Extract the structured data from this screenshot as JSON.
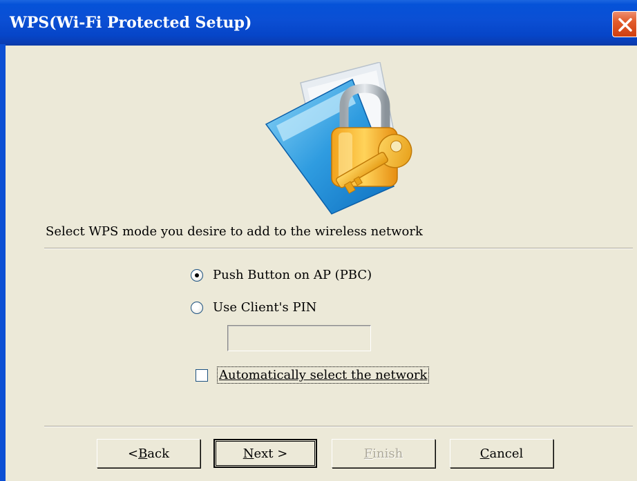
{
  "window": {
    "title": "WPS(Wi-Fi Protected Setup)",
    "close_icon": "close-icon"
  },
  "illustration": {
    "icon": "folder-lock-key-icon"
  },
  "instruction": "Select WPS mode you desire to add to the wireless network",
  "modes": [
    {
      "label": "Push Button on AP (PBC)",
      "selected": true
    },
    {
      "label": "Use Client's PIN",
      "selected": false
    }
  ],
  "pin_input": {
    "value": "",
    "enabled": false
  },
  "auto_select": {
    "label": "Automatically select the network",
    "checked": false
  },
  "buttons": {
    "back": {
      "prefix": "< ",
      "mnemonic": "B",
      "rest": "ack"
    },
    "next": {
      "mnemonic": "N",
      "rest": "ext >"
    },
    "finish": {
      "mnemonic": "F",
      "rest": "inish",
      "enabled": false
    },
    "cancel": {
      "mnemonic": "C",
      "rest": "ancel"
    }
  },
  "colors": {
    "titlebar": "#0b4fd4",
    "dialog_bg": "#ece9d8",
    "close_button": "#e25b2b"
  }
}
